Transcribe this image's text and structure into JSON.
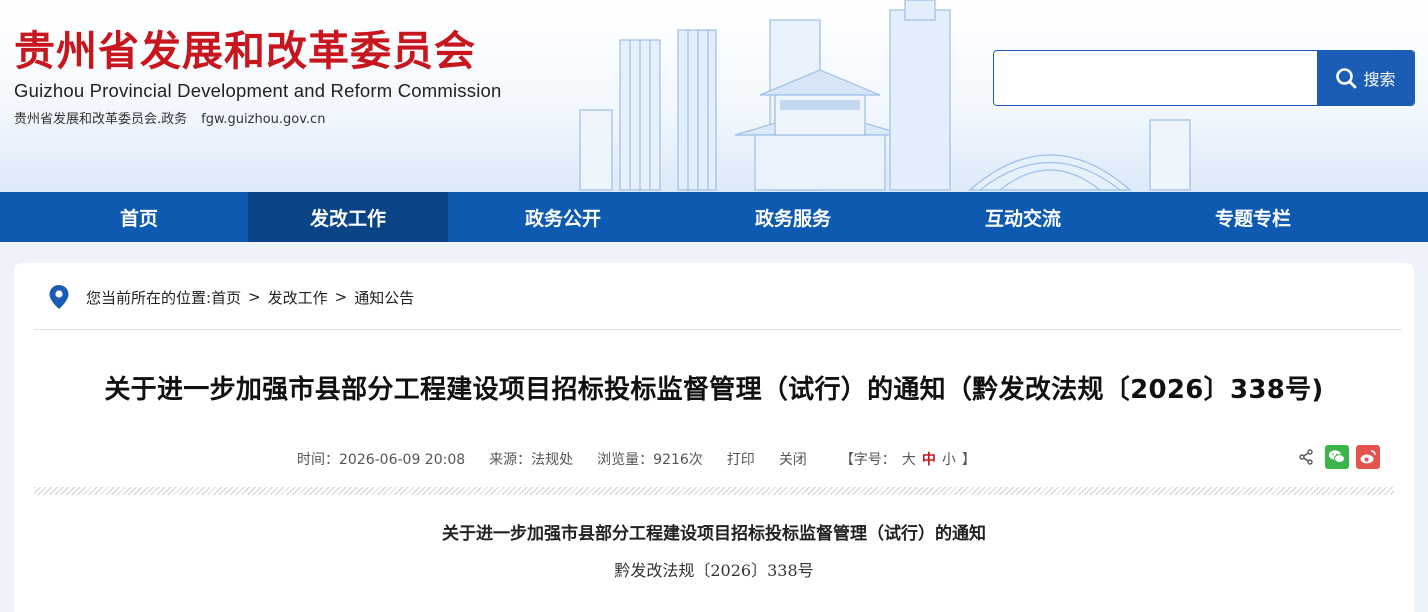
{
  "header": {
    "org_name_cn": "贵州省发展和改革委员会",
    "org_name_en": "Guizhou Provincial Development and Reform Commission",
    "sub_label": "贵州省发展和改革委员会.政务",
    "domain": "fgw.guizhou.gov.cn",
    "search_value": "",
    "search_button": "搜索",
    "accent_color": "#c8161e",
    "brand_blue": "#0e5ab1"
  },
  "nav": {
    "items": [
      {
        "label": "首页"
      },
      {
        "label": "发改工作"
      },
      {
        "label": "政务公开"
      },
      {
        "label": "政务服务"
      },
      {
        "label": "互动交流"
      },
      {
        "label": "专题专栏"
      }
    ],
    "active_index": 1
  },
  "breadcrumb": {
    "prefix": "您当前所在的位置:",
    "items": [
      "首页",
      "发改工作",
      "通知公告"
    ],
    "separator": ">"
  },
  "article": {
    "title": "关于进一步加强市县部分工程建设项目招标投标监督管理（试行）的通知（黔发改法规〔2026〕338号)",
    "time_label": "时间：",
    "time_value": "2026-06-09 20:08",
    "source_label": "来源：",
    "source_value": "法规处",
    "views_label": "浏览量：",
    "views_value": "9216次",
    "print_label": "打印",
    "close_label": "关闭",
    "fontsize_open": "【字号：",
    "fontsize_large": "大",
    "fontsize_medium": "中",
    "fontsize_small": "小",
    "fontsize_close": "】",
    "doc_title": "关于进一步加强市县部分工程建设项目招标投标监督管理（试行）的通知",
    "doc_number": "黔发改法规〔2026〕338号"
  },
  "share": {
    "icons": [
      "share-icon",
      "wechat-icon",
      "weibo-icon"
    ]
  }
}
